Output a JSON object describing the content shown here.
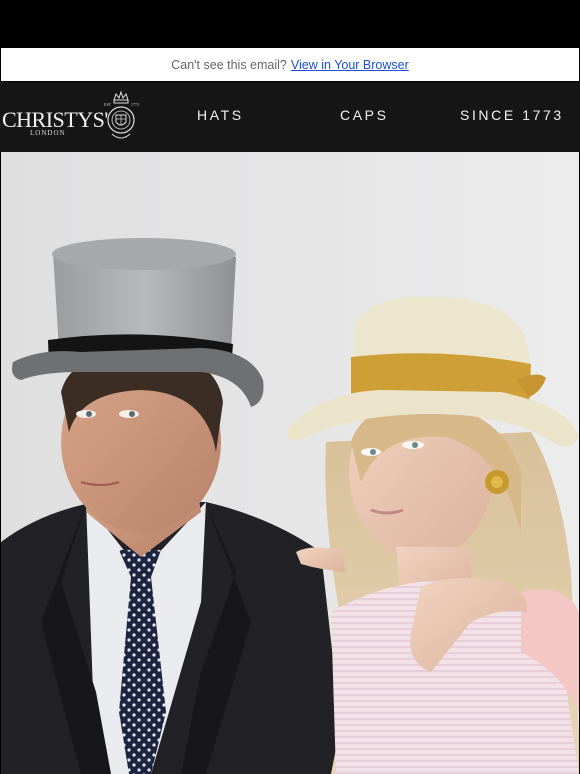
{
  "email_notice": {
    "text": "Can't see this email?",
    "link_label": "View in Your Browser"
  },
  "brand": {
    "name": "CHRISTYS'",
    "location": "LONDON"
  },
  "nav": {
    "items": [
      "HATS",
      "CAPS",
      "SINCE 1773"
    ]
  },
  "colors": {
    "nav_bg": "#161616",
    "link": "#1a4fd6",
    "hero_bg": "#e8e8e9"
  }
}
